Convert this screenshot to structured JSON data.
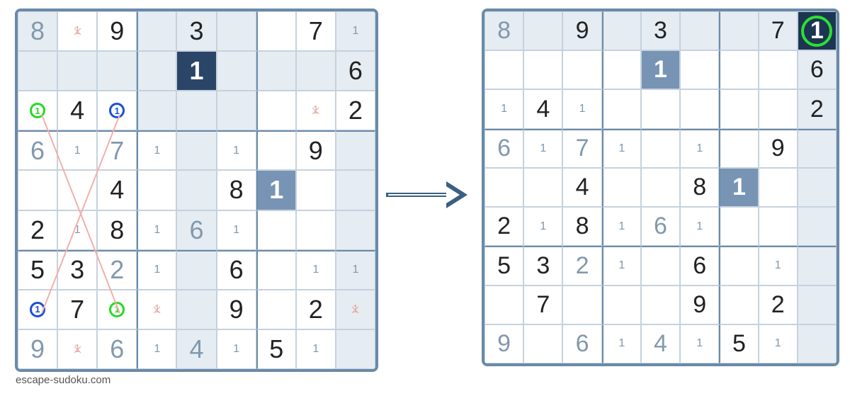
{
  "caption": "escape-sudoku.com",
  "left_grid": {
    "cells": [
      [
        {
          "v": "8",
          "c": "grey",
          "bg": "light"
        },
        {
          "cand_elim": "1"
        },
        {
          "v": "9",
          "c": "black"
        },
        {
          "bg": "light"
        },
        {
          "v": "3",
          "c": "black",
          "bg": "light"
        },
        {
          "bg": "light"
        },
        {},
        {
          "v": "7",
          "c": "black"
        },
        {
          "cand": "1",
          "bg": "light"
        }
      ],
      [
        {
          "bg": "light"
        },
        {
          "bg": "light"
        },
        {
          "bg": "light"
        },
        {
          "bg": "light"
        },
        {
          "v": "1",
          "c": "white",
          "bg": "dark"
        },
        {
          "bg": "light"
        },
        {
          "bg": "light"
        },
        {
          "bg": "light"
        },
        {
          "v": "6",
          "c": "black",
          "bg": "light"
        }
      ],
      [
        {
          "circle": "green",
          "circ_val": "1"
        },
        {
          "v": "4",
          "c": "black"
        },
        {
          "circle": "blue",
          "circ_val": "1"
        },
        {
          "bg": "light"
        },
        {
          "bg": "light"
        },
        {
          "bg": "light"
        },
        {},
        {
          "cand_elim": "1"
        },
        {
          "v": "2",
          "c": "black"
        }
      ],
      [
        {
          "v": "6",
          "c": "grey"
        },
        {
          "cand": "1"
        },
        {
          "v": "7",
          "c": "grey"
        },
        {
          "cand": "1"
        },
        {
          "bg": "light"
        },
        {
          "cand": "1"
        },
        {},
        {
          "v": "9",
          "c": "black"
        },
        {
          "bg": "light"
        }
      ],
      [
        {},
        {},
        {
          "v": "4",
          "c": "black"
        },
        {},
        {
          "bg": "light"
        },
        {
          "v": "8",
          "c": "black"
        },
        {
          "v": "1",
          "c": "white",
          "bg": "med"
        },
        {},
        {
          "bg": "light"
        }
      ],
      [
        {
          "v": "2",
          "c": "black"
        },
        {
          "cand": "1"
        },
        {
          "v": "8",
          "c": "black"
        },
        {
          "cand": "1"
        },
        {
          "v": "6",
          "c": "grey",
          "bg": "light"
        },
        {
          "cand": "1"
        },
        {},
        {},
        {
          "bg": "light"
        }
      ],
      [
        {
          "v": "5",
          "c": "black"
        },
        {
          "v": "3",
          "c": "black"
        },
        {
          "v": "2",
          "c": "grey"
        },
        {
          "cand": "1"
        },
        {
          "bg": "light"
        },
        {
          "v": "6",
          "c": "black"
        },
        {},
        {
          "cand": "1"
        },
        {
          "cand": "1",
          "bg": "light"
        }
      ],
      [
        {
          "circle": "blue",
          "circ_val": "1"
        },
        {
          "v": "7",
          "c": "black"
        },
        {
          "circle": "green",
          "circ_val": "1"
        },
        {
          "cand_elim": "1"
        },
        {
          "bg": "light"
        },
        {
          "v": "9",
          "c": "black"
        },
        {},
        {
          "v": "2",
          "c": "black"
        },
        {
          "cand_elim": "1",
          "bg": "light"
        }
      ],
      [
        {
          "v": "9",
          "c": "grey"
        },
        {
          "cand_elim": "1"
        },
        {
          "v": "6",
          "c": "grey"
        },
        {
          "cand": "1"
        },
        {
          "v": "4",
          "c": "grey",
          "bg": "light"
        },
        {
          "cand": "1"
        },
        {
          "v": "5",
          "c": "black"
        },
        {
          "cand": "1"
        },
        {
          "bg": "light"
        }
      ]
    ]
  },
  "right_grid": {
    "cells": [
      [
        {
          "v": "8",
          "c": "grey",
          "bg": "light"
        },
        {
          "bg": "light"
        },
        {
          "v": "9",
          "c": "black",
          "bg": "light"
        },
        {
          "bg": "light"
        },
        {
          "v": "3",
          "c": "black",
          "bg": "light"
        },
        {
          "bg": "light"
        },
        {
          "bg": "light"
        },
        {
          "v": "7",
          "c": "black",
          "bg": "light"
        },
        {
          "v": "1",
          "c": "white",
          "bg": "corner",
          "corner_circle": true
        }
      ],
      [
        {},
        {},
        {},
        {},
        {
          "v": "1",
          "c": "white",
          "bg": "med"
        },
        {},
        {},
        {},
        {
          "v": "6",
          "c": "black",
          "bg": "light"
        }
      ],
      [
        {
          "cand": "1"
        },
        {
          "v": "4",
          "c": "black"
        },
        {
          "cand": "1"
        },
        {},
        {},
        {},
        {},
        {},
        {
          "v": "2",
          "c": "black",
          "bg": "light"
        }
      ],
      [
        {
          "v": "6",
          "c": "grey"
        },
        {
          "cand": "1"
        },
        {
          "v": "7",
          "c": "grey"
        },
        {
          "cand": "1"
        },
        {},
        {
          "cand": "1"
        },
        {},
        {
          "v": "9",
          "c": "black"
        },
        {
          "bg": "light"
        }
      ],
      [
        {},
        {},
        {
          "v": "4",
          "c": "black"
        },
        {},
        {},
        {
          "v": "8",
          "c": "black"
        },
        {
          "v": "1",
          "c": "white",
          "bg": "med"
        },
        {},
        {
          "bg": "light"
        }
      ],
      [
        {
          "v": "2",
          "c": "black"
        },
        {
          "cand": "1"
        },
        {
          "v": "8",
          "c": "black"
        },
        {
          "cand": "1"
        },
        {
          "v": "6",
          "c": "grey"
        },
        {
          "cand": "1"
        },
        {},
        {},
        {
          "bg": "light"
        }
      ],
      [
        {
          "v": "5",
          "c": "black"
        },
        {
          "v": "3",
          "c": "black"
        },
        {
          "v": "2",
          "c": "grey"
        },
        {
          "cand": "1"
        },
        {},
        {
          "v": "6",
          "c": "black"
        },
        {},
        {
          "cand": "1"
        },
        {
          "bg": "light"
        }
      ],
      [
        {},
        {
          "v": "7",
          "c": "black"
        },
        {},
        {},
        {},
        {
          "v": "9",
          "c": "black"
        },
        {},
        {
          "v": "2",
          "c": "black"
        },
        {
          "bg": "light"
        }
      ],
      [
        {
          "v": "9",
          "c": "grey"
        },
        {},
        {
          "v": "6",
          "c": "grey"
        },
        {
          "cand": "1"
        },
        {
          "v": "4",
          "c": "grey"
        },
        {
          "cand": "1"
        },
        {
          "v": "5",
          "c": "black"
        },
        {
          "cand": "1"
        },
        {
          "bg": "light"
        }
      ]
    ]
  },
  "chart_data": {
    "type": "table",
    "description": "Sudoku X-wing strategy diagram showing elimination of candidate 1s",
    "left_board": {
      "given_values": {
        "r1": [
          8,
          null,
          9,
          null,
          3,
          null,
          null,
          7,
          null
        ],
        "r2": [
          null,
          null,
          null,
          null,
          1,
          null,
          null,
          null,
          6
        ],
        "r3": [
          null,
          4,
          null,
          null,
          null,
          null,
          null,
          null,
          2
        ],
        "r4": [
          6,
          null,
          7,
          null,
          null,
          null,
          null,
          9,
          null
        ],
        "r5": [
          null,
          null,
          4,
          null,
          null,
          8,
          1,
          null,
          null
        ],
        "r6": [
          2,
          null,
          8,
          null,
          6,
          null,
          null,
          null,
          null
        ],
        "r7": [
          5,
          3,
          2,
          null,
          null,
          6,
          null,
          null,
          null
        ],
        "r8": [
          null,
          7,
          null,
          null,
          null,
          9,
          null,
          2,
          null
        ],
        "r9": [
          9,
          null,
          6,
          null,
          4,
          null,
          5,
          null,
          null
        ]
      },
      "xwing_corners_green": [
        "r3c1",
        "r8c3"
      ],
      "xwing_corners_blue": [
        "r3c3",
        "r8c1"
      ],
      "eliminated_candidates_1": [
        "r1c2",
        "r3c8",
        "r8c4",
        "r8c9",
        "r9c2"
      ],
      "highlighted_1s": {
        "r2c5": "dark",
        "r5c7": "med"
      }
    },
    "right_board": {
      "result_cell": {
        "pos": "r1c9",
        "value": 1
      },
      "highlighted_1s": {
        "r2c5": "med",
        "r5c7": "med"
      }
    }
  }
}
